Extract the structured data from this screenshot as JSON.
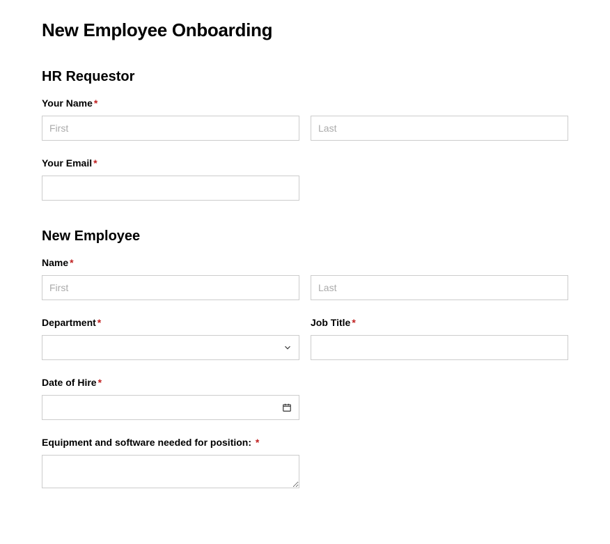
{
  "page_title": "New Employee Onboarding",
  "sections": {
    "hr": {
      "title": "HR Requestor",
      "name_label": "Your Name",
      "first_placeholder": "First",
      "last_placeholder": "Last",
      "email_label": "Your Email"
    },
    "emp": {
      "title": "New Employee",
      "name_label": "Name",
      "first_placeholder": "First",
      "last_placeholder": "Last",
      "dept_label": "Department",
      "jobtitle_label": "Job Title",
      "date_label": "Date of Hire",
      "equipment_label": "Equipment and software needed for position:"
    }
  },
  "required_mark": "*"
}
